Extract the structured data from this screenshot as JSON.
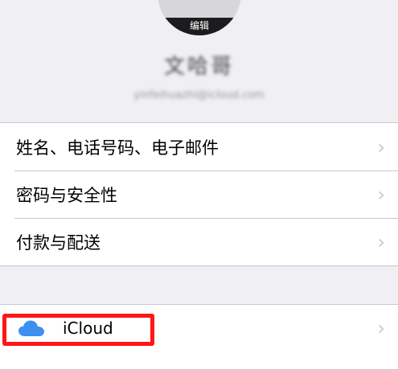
{
  "profile": {
    "avatar_edit_label": "编辑",
    "name": "文哈哥",
    "email": "yinfeihuazhi@icloud.com"
  },
  "settings_group_1": {
    "items": [
      {
        "label": "姓名、电话号码、电子邮件"
      },
      {
        "label": "密码与安全性"
      },
      {
        "label": "付款与配送"
      }
    ]
  },
  "settings_group_2": {
    "items": [
      {
        "label": "iCloud",
        "icon": "icloud-icon"
      }
    ]
  },
  "colors": {
    "background": "#efeff4",
    "highlight": "#ff1616",
    "icloud_blue": "#3d8ff0"
  }
}
